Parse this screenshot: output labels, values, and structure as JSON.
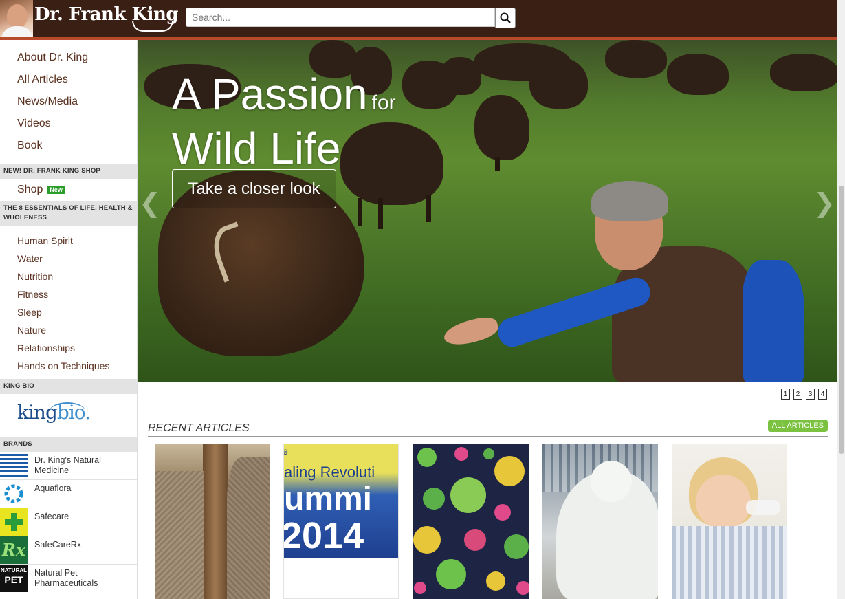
{
  "header": {
    "site_name": "Dr. Frank King",
    "search_placeholder": "Search..."
  },
  "sidebar": {
    "main_nav": [
      "About Dr. King",
      "All Articles",
      "News/Media",
      "Videos",
      "Book"
    ],
    "shop_section": {
      "heading": "NEW! DR. FRANK KING SHOP",
      "label": "Shop",
      "badge": "New"
    },
    "essentials_section": {
      "heading": "THE 8 ESSENTIALS OF LIFE, HEALTH & WHOLENESS",
      "items": [
        "Human Spirit",
        "Water",
        "Nutrition",
        "Fitness",
        "Sleep",
        "Nature",
        "Relationships",
        "Hands on Techniques"
      ]
    },
    "kingbio_section": {
      "heading": "KING BIO",
      "logo_king": "king",
      "logo_bio": "bio."
    },
    "brands_section": {
      "heading": "BRANDS",
      "items": [
        {
          "label": "Dr. King's Natural Medicine",
          "icon": "natural-medicine-icon"
        },
        {
          "label": "Aquaflora",
          "icon": "aquaflora-icon"
        },
        {
          "label": "Safecare",
          "icon": "safecare-icon"
        },
        {
          "label": "SafeCareRx",
          "icon": "safecarerx-icon"
        },
        {
          "label": "Natural Pet Pharmaceuticals",
          "icon": "natural-pet-icon"
        }
      ]
    }
  },
  "hero": {
    "title_line1": "A Passion",
    "title_for": "for",
    "title_line2": "Wild Life",
    "cta": "Take a closer look",
    "prev_arrow": "❮",
    "next_arrow": "❯"
  },
  "pager": [
    "1",
    "2",
    "3",
    "4"
  ],
  "recent": {
    "title": "RECENT ARTICLES",
    "all_button": "ALL ARTICLES",
    "cards": [
      {
        "image": "elephant"
      },
      {
        "image": "healing-revolution-summit",
        "text1": "e",
        "text2": "aling Revoluti",
        "text3": "ummi",
        "text4": "2014"
      },
      {
        "image": "pollen"
      },
      {
        "image": "white-horse-statue"
      },
      {
        "image": "boy-drinking"
      }
    ]
  },
  "colors": {
    "header_bg": "#3a1f14",
    "accent": "#b84a2c",
    "nav_text": "#5a3221",
    "badge_green": "#2a9d2a",
    "all_btn_green": "#7cc241"
  }
}
